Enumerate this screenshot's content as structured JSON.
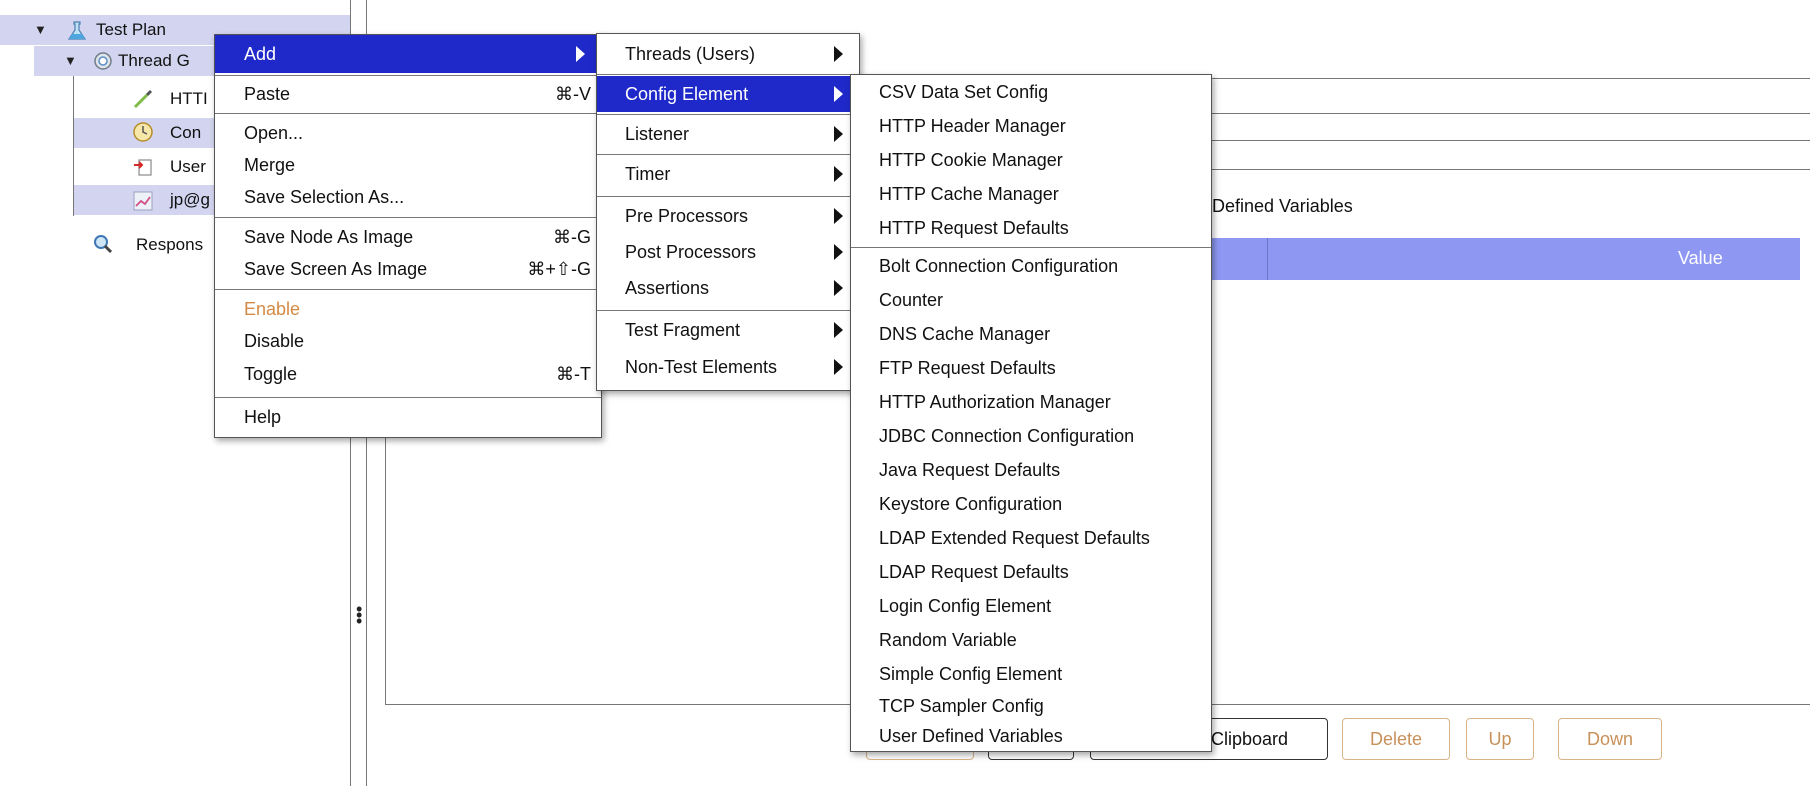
{
  "tree": {
    "items": [
      {
        "label": "Test Plan",
        "icon": "test-plan-icon"
      },
      {
        "label": "Thread G",
        "icon": "gear-icon"
      },
      {
        "label": "HTTI",
        "icon": "pipette-icon"
      },
      {
        "label": "Con",
        "icon": "timer-icon"
      },
      {
        "label": "User",
        "icon": "user-variables-icon"
      },
      {
        "label": "jp@g",
        "icon": "graph-icon"
      },
      {
        "label": "Respons",
        "icon": "magnifier-icon"
      }
    ]
  },
  "context_menu": {
    "items": [
      {
        "label": "Add",
        "shortcut": ""
      },
      {
        "label": "Paste",
        "shortcut": "⌘-V"
      },
      {
        "label": "Open...",
        "shortcut": ""
      },
      {
        "label": "Merge",
        "shortcut": ""
      },
      {
        "label": "Save Selection As...",
        "shortcut": ""
      },
      {
        "label": "Save Node As Image",
        "shortcut": "⌘-G"
      },
      {
        "label": "Save Screen As Image",
        "shortcut": "⌘+⇧-G"
      },
      {
        "label": "Enable",
        "shortcut": ""
      },
      {
        "label": "Disable",
        "shortcut": ""
      },
      {
        "label": "Toggle",
        "shortcut": "⌘-T"
      },
      {
        "label": "Help",
        "shortcut": ""
      }
    ]
  },
  "add_submenu": {
    "items": [
      {
        "label": "Threads (Users)"
      },
      {
        "label": "Config Element"
      },
      {
        "label": "Listener"
      },
      {
        "label": "Timer"
      },
      {
        "label": "Pre Processors"
      },
      {
        "label": "Post Processors"
      },
      {
        "label": "Assertions"
      },
      {
        "label": "Test Fragment"
      },
      {
        "label": "Non-Test Elements"
      }
    ]
  },
  "config_element_submenu": {
    "items": [
      {
        "label": "CSV Data Set Config"
      },
      {
        "label": "HTTP Header Manager"
      },
      {
        "label": "HTTP Cookie Manager"
      },
      {
        "label": "HTTP Cache Manager"
      },
      {
        "label": "HTTP Request Defaults"
      },
      {
        "label": "Bolt Connection Configuration"
      },
      {
        "label": "Counter"
      },
      {
        "label": "DNS Cache Manager"
      },
      {
        "label": "FTP Request Defaults"
      },
      {
        "label": "HTTP Authorization Manager"
      },
      {
        "label": "JDBC Connection Configuration"
      },
      {
        "label": "Java Request Defaults"
      },
      {
        "label": "Keystore Configuration"
      },
      {
        "label": "LDAP Extended Request Defaults"
      },
      {
        "label": "LDAP Request Defaults"
      },
      {
        "label": "Login Config Element"
      },
      {
        "label": "Random Variable"
      },
      {
        "label": "Simple Config Element"
      },
      {
        "label": "TCP Sampler Config"
      },
      {
        "label": "User Defined Variables"
      }
    ]
  },
  "panel": {
    "variables_label": "Defined Variables",
    "table_value_header": "Value",
    "buttons": {
      "clipboard": "Clipboard",
      "delete": "Delete",
      "up": "Up",
      "down": "Down"
    }
  },
  "colors": {
    "menu_highlight": "#1f29c9",
    "table_header": "#8e98f3",
    "tree_selection": "#d3d5f0",
    "disabled_text": "#d48a44"
  }
}
